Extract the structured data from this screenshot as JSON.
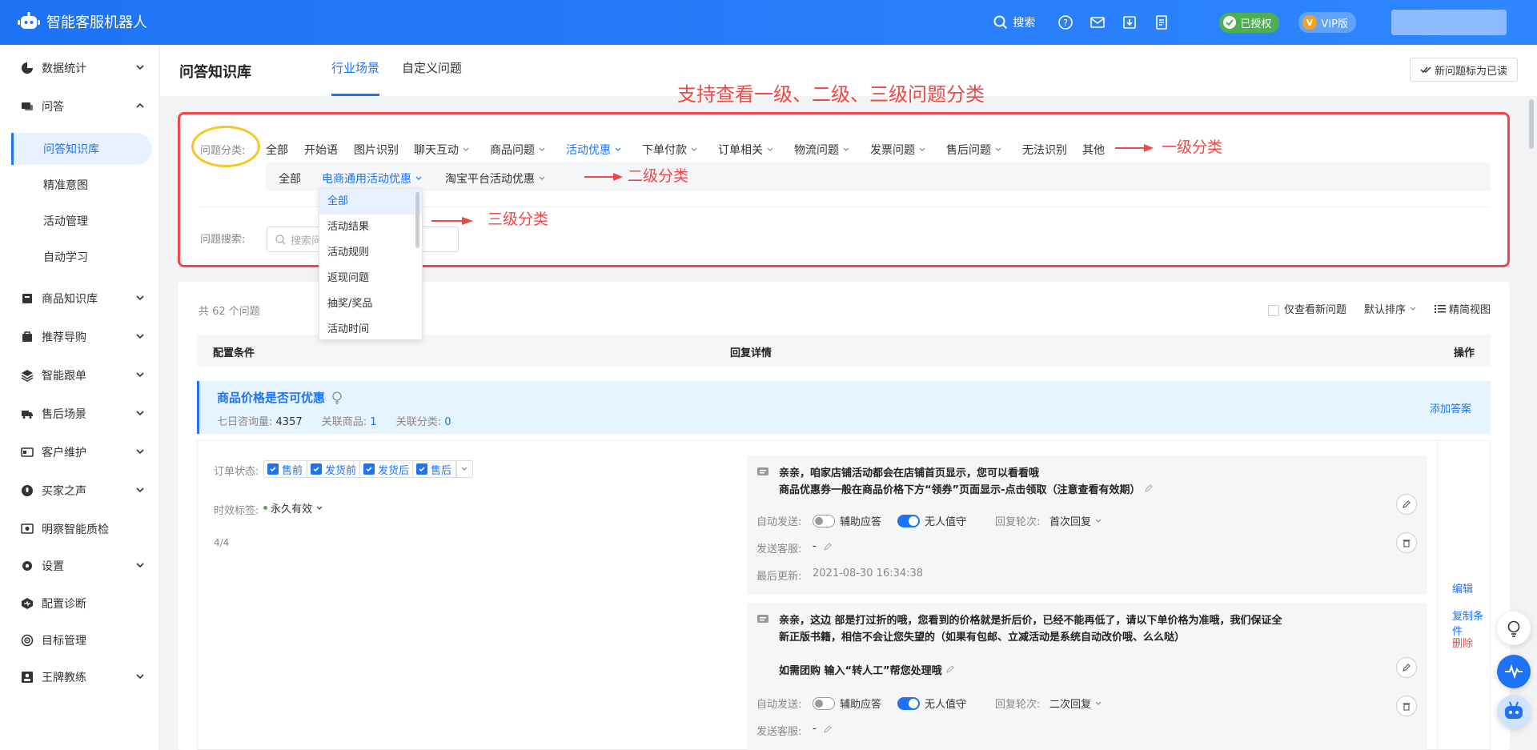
{
  "app": {
    "title": "智能客服机器人"
  },
  "topbar": {
    "search_label": "搜索",
    "authorized_label": "已授权",
    "vip_label": "VIP版"
  },
  "sidebar": {
    "items": [
      {
        "label": "数据统计",
        "icon": "pie-chart-icon"
      },
      {
        "label": "问答",
        "icon": "chat-icon"
      },
      {
        "label": "问答知识库",
        "sub": true,
        "active": true
      },
      {
        "label": "精准意图",
        "sub": true
      },
      {
        "label": "活动管理",
        "sub": true
      },
      {
        "label": "自动学习",
        "sub": true
      },
      {
        "label": "商品知识库",
        "icon": "book-icon"
      },
      {
        "label": "推荐导购",
        "icon": "bag-icon"
      },
      {
        "label": "智能跟单",
        "icon": "layers-icon"
      },
      {
        "label": "售后场景",
        "icon": "truck-icon"
      },
      {
        "label": "客户维护",
        "icon": "card-icon"
      },
      {
        "label": "买家之声",
        "icon": "voice-icon"
      },
      {
        "label": "明察智能质检",
        "icon": "inspect-icon"
      },
      {
        "label": "设置",
        "icon": "gear-icon"
      },
      {
        "label": "配置诊断",
        "icon": "diagnose-icon"
      },
      {
        "label": "目标管理",
        "icon": "target-icon"
      },
      {
        "label": "王牌教练",
        "icon": "coach-icon"
      }
    ]
  },
  "header": {
    "title": "问答知识库",
    "tabs": [
      {
        "label": "行业场景",
        "active": true
      },
      {
        "label": "自定义问题",
        "active": false
      }
    ],
    "mark_read_label": "新问题标为已读"
  },
  "annotations": {
    "main": "支持查看一级、二级、三级问题分类",
    "level1": "一级分类",
    "level2": "二级分类",
    "level3": "三级分类"
  },
  "filter": {
    "category_label": "问题分类:",
    "level1": [
      {
        "label": "全部",
        "dropdown": false
      },
      {
        "label": "开始语",
        "dropdown": false
      },
      {
        "label": "图片识别",
        "dropdown": false
      },
      {
        "label": "聊天互动",
        "dropdown": true
      },
      {
        "label": "商品问题",
        "dropdown": true
      },
      {
        "label": "活动优惠",
        "dropdown": true,
        "active": true
      },
      {
        "label": "下单付款",
        "dropdown": true
      },
      {
        "label": "订单相关",
        "dropdown": true
      },
      {
        "label": "物流问题",
        "dropdown": true
      },
      {
        "label": "发票问题",
        "dropdown": true
      },
      {
        "label": "售后问题",
        "dropdown": true
      },
      {
        "label": "无法识别",
        "dropdown": false
      },
      {
        "label": "其他",
        "dropdown": false
      }
    ],
    "level2": [
      {
        "label": "全部",
        "dropdown": false
      },
      {
        "label": "电商通用活动优惠",
        "dropdown": true,
        "active": true
      },
      {
        "label": "淘宝平台活动优惠",
        "dropdown": true
      }
    ],
    "level3": [
      "全部",
      "活动结果",
      "活动规则",
      "返现问题",
      "抽奖/奖品",
      "活动时间"
    ],
    "search_label": "问题搜索:",
    "search_placeholder": "搜索问"
  },
  "list": {
    "count": "共 62 个问题",
    "only_new_label": "仅查看新问题",
    "sort_label": "默认排序",
    "view_label": "精简视图",
    "columns": [
      "配置条件",
      "回复详情",
      "操作"
    ]
  },
  "question": {
    "title": "商品价格是否可优惠",
    "meta_consult_label": "七日咨询量:",
    "meta_consult_value": "4357",
    "meta_goods_label": "关联商品:",
    "meta_goods_value": "1",
    "meta_cat_label": "关联分类:",
    "meta_cat_value": "0",
    "add_answer": "添加答案",
    "order_status_label": "订单状态:",
    "order_status": [
      "售前",
      "发货前",
      "发货后",
      "售后"
    ],
    "time_label": "时效标签:",
    "time_value": "永久有效",
    "fraction": "4/4",
    "actions": [
      "编辑",
      "复制条件",
      "删除"
    ],
    "replies": [
      {
        "lines": [
          "亲亲，咱家店铺活动都会在店铺首页显示，您可以看看哦",
          "商品优惠券一般在商品价格下方“领券”页面显示-点击领取（注意查看有效期）"
        ],
        "auto_send_label": "自动发送:",
        "assist_label": "辅助应答",
        "unattended_label": "无人值守",
        "round_label": "回复轮次:",
        "round_value": "首次回复",
        "agent_label": "发送客服:",
        "agent_value": "-",
        "updated_label": "最后更新:",
        "updated_value": "2021-08-30 16:34:38"
      },
      {
        "lines": [
          "亲亲，这边 部是打过折的哦，您看到的价格就是折后价，已经不能再低了，请以下单价格为准哦，我们保证全",
          "新正版书籍，相信不会让您失望的（如果有包邮、立减活动是系统自动改价哦、么么哒）",
          "",
          "如需团购 输入“转人工”帮您处理哦"
        ],
        "auto_send_label": "自动发送:",
        "assist_label": "辅助应答",
        "unattended_label": "无人值守",
        "round_label": "回复轮次:",
        "round_value": "二次回复",
        "agent_label": "发送客服:",
        "agent_value": "-"
      }
    ]
  },
  "colors": {
    "primary": "#1e72f5",
    "annotation": "#f04848",
    "highlight": "#f7c524",
    "success": "#4cb050"
  }
}
